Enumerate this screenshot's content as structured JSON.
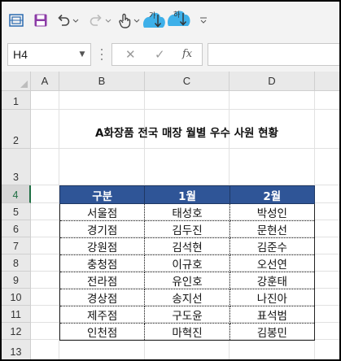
{
  "toolbar": {
    "icons": [
      "screen-capture-icon",
      "save-icon",
      "undo-icon",
      "redo-icon",
      "touch-mode-icon",
      "sort-ascending-icon",
      "sort-descending-icon",
      "customize-toolbar-icon"
    ],
    "highlight_color": "#2aa8e8"
  },
  "formula_bar": {
    "name_box": "H4",
    "fx_label": "fx",
    "formula": ""
  },
  "sheet": {
    "columns": [
      "A",
      "B",
      "C",
      "D"
    ],
    "rows": [
      "1",
      "2",
      "3",
      "4",
      "5",
      "6",
      "7",
      "8",
      "9",
      "10",
      "11",
      "12",
      "13"
    ],
    "selected_row": "4",
    "title": "A화장품 전국 매장 월별 우수 사원 현황",
    "table": {
      "headers": [
        "구분",
        "1월",
        "2월"
      ],
      "rows": [
        [
          "서울점",
          "태성호",
          "박성인"
        ],
        [
          "경기점",
          "김두진",
          "문현선"
        ],
        [
          "강원점",
          "김석현",
          "김준수"
        ],
        [
          "충청점",
          "이규호",
          "오선연"
        ],
        [
          "전라점",
          "유인호",
          "강훈태"
        ],
        [
          "경상점",
          "송지선",
          "나진아"
        ],
        [
          "제주점",
          "구도윤",
          "표석범"
        ],
        [
          "인천점",
          "마혁진",
          "김봉민"
        ]
      ],
      "header_color": "#2f5597"
    }
  }
}
